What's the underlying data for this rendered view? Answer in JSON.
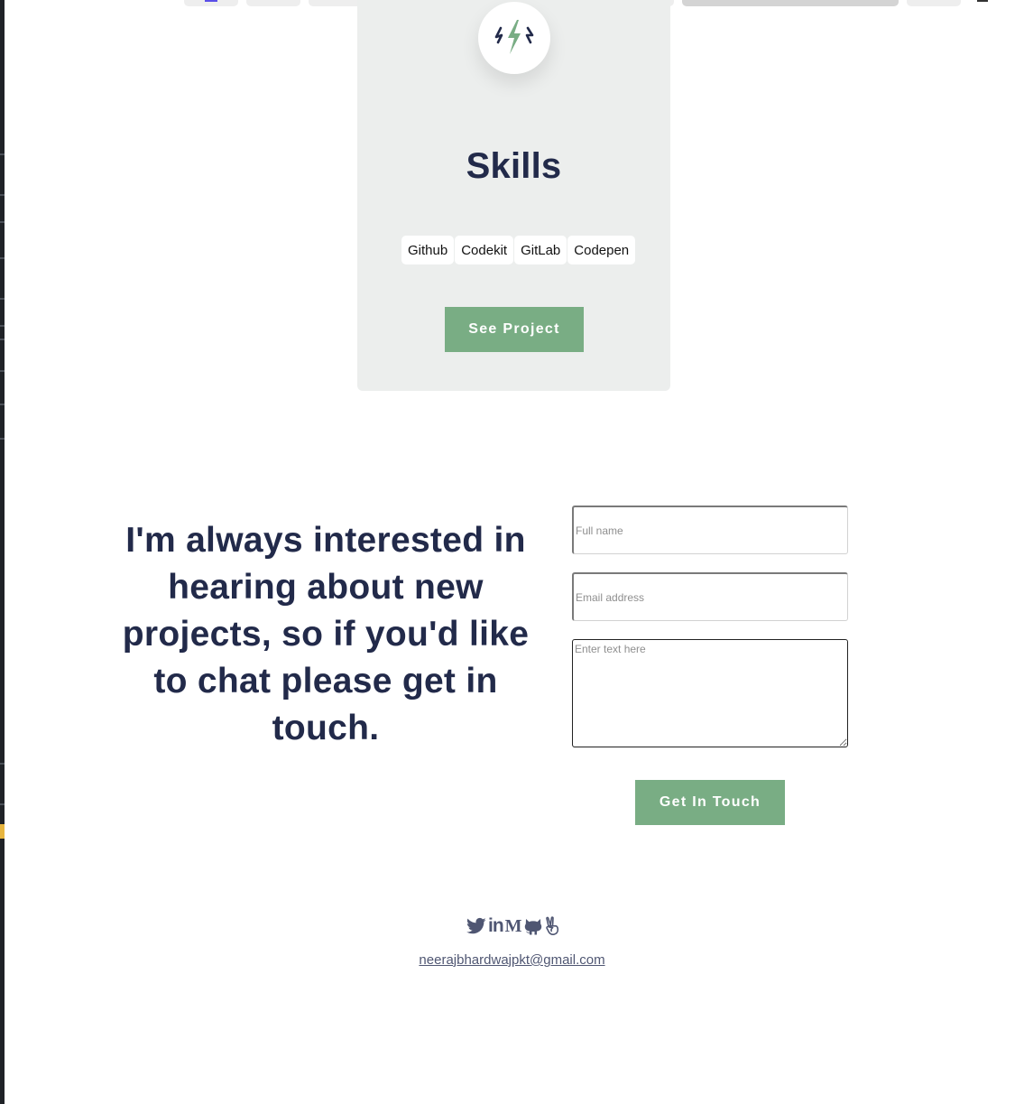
{
  "skills_card": {
    "title": "Skills",
    "tags": [
      "Github",
      "Codekit",
      "GitLab",
      "Codepen"
    ],
    "button_label": "See Project"
  },
  "contact": {
    "heading": "I'm always interested in hearing about new projects, so if you'd like to chat please get in touch.",
    "full_name_placeholder": "Full name",
    "email_placeholder": "Email address",
    "message_placeholder": "Enter text here",
    "submit_label": "Get In Touch"
  },
  "footer": {
    "social_icons": [
      "twitter-icon",
      "linkedin-icon",
      "medium-icon",
      "github-icon",
      "angellist-icon"
    ],
    "linkedin_glyph": "in",
    "medium_glyph": "M",
    "email": "neerajbhardwajpkt@gmail.com"
  },
  "colors": {
    "accent_green": "#79ad84",
    "heading_navy": "#222a4a",
    "card_background": "#eceeed",
    "footer_text": "#4f5672"
  }
}
